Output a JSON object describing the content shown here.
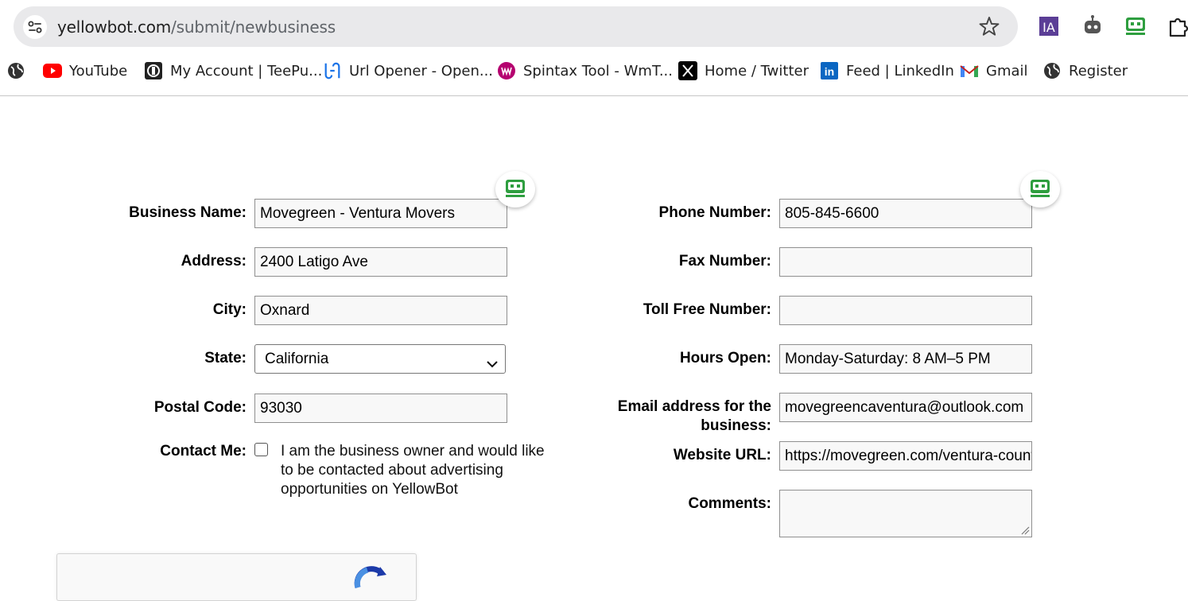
{
  "browser": {
    "url_host": "yellowbot.com",
    "url_path": "/submit/newbusiness",
    "extensions": [
      "ia-extension-icon",
      "robot-extension-icon",
      "green-bot-extension-icon",
      "puzzle-extensions-icon"
    ]
  },
  "bookmarks": [
    {
      "label": "",
      "icon": "globe-icon"
    },
    {
      "label": "YouTube",
      "icon": "youtube-icon"
    },
    {
      "label": "My Account | TeePu...",
      "icon": "teepublic-icon"
    },
    {
      "label": "Url Opener - Open...",
      "icon": "url-opener-icon"
    },
    {
      "label": "Spintax Tool - WmT...",
      "icon": "spintax-icon"
    },
    {
      "label": "Home / Twitter",
      "icon": "x-twitter-icon"
    },
    {
      "label": "Feed | LinkedIn",
      "icon": "linkedin-icon"
    },
    {
      "label": "Gmail",
      "icon": "gmail-icon"
    },
    {
      "label": "Register",
      "icon": "globe-icon"
    }
  ],
  "form": {
    "business_name": {
      "label": "Business Name:",
      "value": "Movegreen - Ventura Movers"
    },
    "address": {
      "label": "Address:",
      "value": "2400 Latigo Ave"
    },
    "city": {
      "label": "City:",
      "value": "Oxnard"
    },
    "state": {
      "label": "State:",
      "value": "California"
    },
    "postal_code": {
      "label": "Postal Code:",
      "value": "93030"
    },
    "contact_me": {
      "label": "Contact Me:",
      "text": "I am the business owner and would like to be contacted about advertising opportunities on YellowBot",
      "checked": false
    },
    "phone": {
      "label": "Phone Number:",
      "value": "805-845-6600"
    },
    "fax": {
      "label": "Fax Number:",
      "value": ""
    },
    "toll_free": {
      "label": "Toll Free Number:",
      "value": ""
    },
    "hours": {
      "label": "Hours Open:",
      "value": "Monday-Saturday: 8 AM–5 PM"
    },
    "email": {
      "label_line1": "Email address for the",
      "label_line2": "business:",
      "value": "movegreencaventura@outlook.com"
    },
    "website": {
      "label": "Website URL:",
      "value": "https://movegreen.com/ventura-county-movers/"
    },
    "comments": {
      "label": "Comments:",
      "value": ""
    }
  },
  "colors": {
    "bot_green": "#2e9e3f",
    "youtube_red": "#ff0000",
    "linkedin_blue": "#0a66c2",
    "spintax_magenta": "#b5006f",
    "url_opener_blue": "#1a73e8",
    "ia_purple": "#5b3e96"
  }
}
